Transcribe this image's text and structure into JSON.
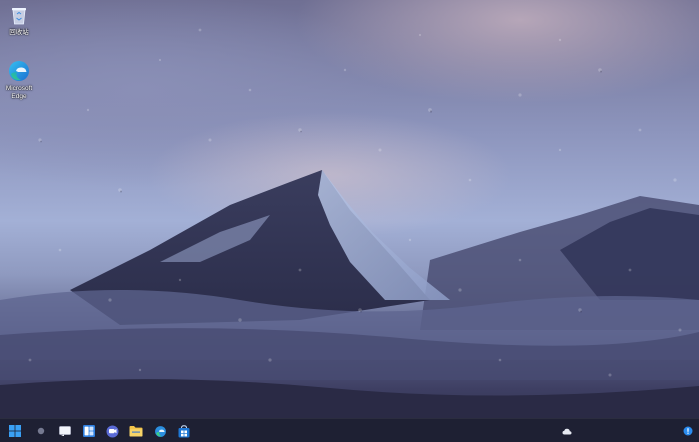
{
  "desktop": {
    "icons": [
      {
        "label": "回收站",
        "icon": "recycle-bin-icon"
      },
      {
        "label": "Microsoft Edge",
        "icon": "edge-icon"
      }
    ]
  },
  "taskbar": {
    "items": [
      {
        "name": "Start",
        "icon": "windows-start-icon"
      },
      {
        "name": "Search",
        "icon": "search-icon"
      },
      {
        "name": "Task View",
        "icon": "task-view-icon"
      },
      {
        "name": "Widgets",
        "icon": "widgets-icon"
      },
      {
        "name": "Chat",
        "icon": "chat-icon"
      },
      {
        "name": "File Explorer",
        "icon": "folder-icon"
      },
      {
        "name": "Microsoft Edge",
        "icon": "edge-icon"
      },
      {
        "name": "Microsoft Store",
        "icon": "store-icon"
      }
    ],
    "tray": [
      {
        "name": "Weather / cloud",
        "icon": "cloud-icon"
      },
      {
        "name": "Notifications",
        "icon": "notification-icon"
      }
    ]
  },
  "colors": {
    "accent": "#2a8cf0",
    "taskbar_bg": "#1c1e30"
  }
}
